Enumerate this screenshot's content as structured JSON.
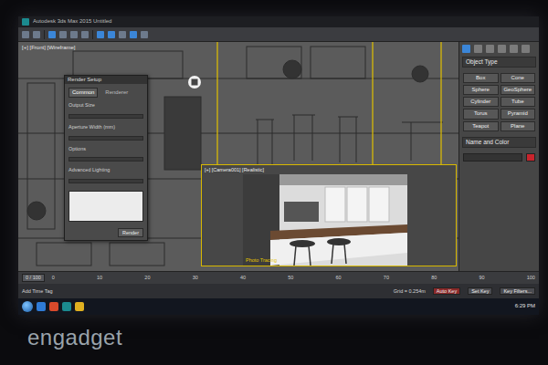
{
  "window": {
    "title": "Autodesk 3ds Max 2015   Untitled"
  },
  "viewport": {
    "label": "[+] [Front] [Wireframe]"
  },
  "dialog": {
    "title": "Render Setup",
    "tabs": [
      {
        "label": "Common",
        "selected": true
      },
      {
        "label": "Renderer",
        "selected": false
      }
    ],
    "rows": [
      "Output Size",
      "Aperture Width (mm)",
      "Options",
      "Advanced Lighting"
    ],
    "buttons": [
      "Render"
    ]
  },
  "render_view": {
    "label": "[+] [Camera001] [Realistic]",
    "caption": "Photo Tracing"
  },
  "command_panel": {
    "section": "Object Type",
    "objects": [
      "Box",
      "Cone",
      "Sphere",
      "GeoSphere",
      "Cylinder",
      "Tube",
      "Torus",
      "Pyramid",
      "Teapot",
      "Plane"
    ],
    "name_section": "Name and Color"
  },
  "timeline": {
    "position": "0 / 100",
    "ticks": [
      "0",
      "10",
      "20",
      "30",
      "40",
      "50",
      "60",
      "70",
      "80",
      "90",
      "100"
    ]
  },
  "status_bar": {
    "grid": "Grid = 0.254m",
    "time_tag": "Add Time Tag",
    "buttons": [
      "Auto Key",
      "Set Key",
      "Key Filters..."
    ]
  },
  "taskbar": {
    "time": "6:29 PM"
  },
  "watermark": "engadget"
}
